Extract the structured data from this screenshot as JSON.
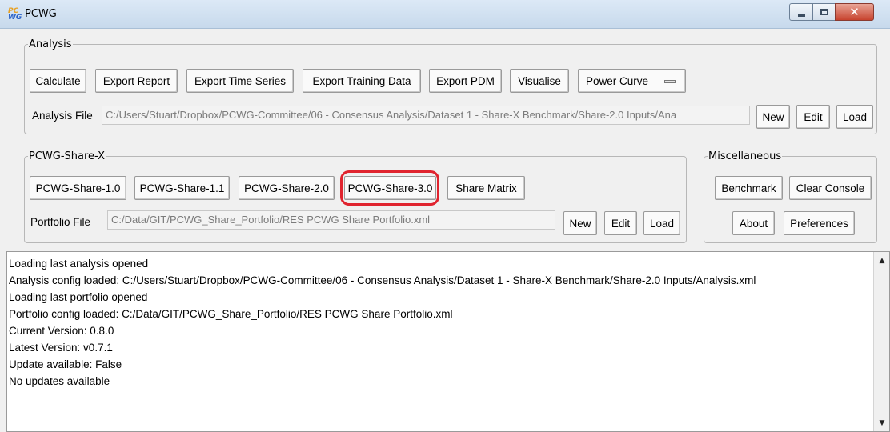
{
  "window": {
    "title": "PCWG",
    "icon": "pcwg-app-icon",
    "icon_top": "PC",
    "icon_bottom": "WG"
  },
  "analysis": {
    "legend": "Analysis",
    "buttons": {
      "calculate": "Calculate",
      "export_report": "Export Report",
      "export_time_series": "Export Time Series",
      "export_training_data": "Export Training Data",
      "export_pdm": "Export PDM",
      "visualise": "Visualise",
      "power_curve": "Power Curve"
    },
    "file_label": "Analysis File",
    "file_path": "C:/Users/Stuart/Dropbox/PCWG-Committee/06 - Consensus Analysis/Dataset 1 - Share-X Benchmark/Share-2.0 Inputs/Ana",
    "new": "New",
    "edit": "Edit",
    "load": "Load"
  },
  "share": {
    "legend": "PCWG-Share-X",
    "buttons": {
      "share_1_0": "PCWG-Share-1.0",
      "share_1_1": "PCWG-Share-1.1",
      "share_2_0": "PCWG-Share-2.0",
      "share_3_0": "PCWG-Share-3.0",
      "share_matrix": "Share Matrix"
    },
    "highlight_color": "#e0242f",
    "file_label": "Portfolio File",
    "file_path": "C:/Data/GIT/PCWG_Share_Portfolio/RES PCWG Share Portfolio.xml",
    "new": "New",
    "edit": "Edit",
    "load": "Load"
  },
  "misc": {
    "legend": "Miscellaneous",
    "benchmark": "Benchmark",
    "clear_console": "Clear Console",
    "about": "About",
    "preferences": "Preferences"
  },
  "console": {
    "lines": [
      "Loading last analysis opened",
      "Analysis config loaded: C:/Users/Stuart/Dropbox/PCWG-Committee/06 - Consensus Analysis/Dataset 1 - Share-X Benchmark/Share-2.0 Inputs/Analysis.xml",
      "Loading last portfolio opened",
      "Portfolio config loaded: C:/Data/GIT/PCWG_Share_Portfolio/RES PCWG Share Portfolio.xml",
      "Current Version: 0.8.0",
      "Latest Version: v0.7.1",
      "Update available: False",
      "No updates available"
    ]
  }
}
